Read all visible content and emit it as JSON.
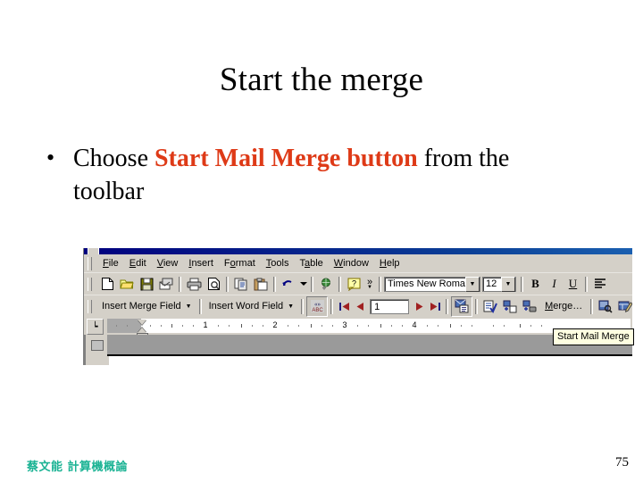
{
  "slide": {
    "title": "Start the merge",
    "bullet": {
      "marker": "•",
      "text_before": "Choose ",
      "highlight": "Start Mail Merge button",
      "text_after": " from the",
      "text_line2": "toolbar",
      "highlight_color": "#DE3A17"
    },
    "footer": "蔡文能  計算機概論",
    "footer_color": "#1BB394",
    "page_number": "75"
  },
  "screenshot": {
    "menubar": [
      {
        "label": "File",
        "accel": "F",
        "rest": "ile"
      },
      {
        "label": "Edit",
        "accel": "E",
        "rest": "dit"
      },
      {
        "label": "View",
        "accel": "V",
        "rest": "iew"
      },
      {
        "label": "Insert",
        "accel": "I",
        "rest": "nsert"
      },
      {
        "label": "Format",
        "accel": "o",
        "pre": "F",
        "rest": "rmat"
      },
      {
        "label": "Tools",
        "accel": "T",
        "rest": "ools"
      },
      {
        "label": "Table",
        "accel": "a",
        "pre": "T",
        "rest": "ble"
      },
      {
        "label": "Window",
        "accel": "W",
        "rest": "indow"
      },
      {
        "label": "Help",
        "accel": "H",
        "rest": "elp"
      }
    ],
    "standard_toolbar": {
      "icons": [
        "new-document-icon",
        "open-folder-icon",
        "save-icon",
        "email-icon",
        "print-icon",
        "print-preview-icon",
        "copy-icon",
        "paste-icon",
        "undo-icon",
        "insert-hyperlink-icon",
        "help-icon"
      ],
      "overflow_label": "»",
      "font_name": "Times New Roman",
      "font_size": "12",
      "bold_label": "B",
      "italic_label": "I",
      "underline_label": "U"
    },
    "mailmerge_toolbar": {
      "insert_merge_field": "Insert Merge Field",
      "insert_word_field": "Insert Word Field",
      "view_merged_data_icon": "view-merged-data-icon",
      "first_record_icon": "first-record-icon",
      "prev_record_icon": "previous-record-icon",
      "record_number": "1",
      "next_record_icon": "next-record-icon",
      "last_record_icon": "last-record-icon",
      "start_mail_merge_icon": "start-mail-merge-icon",
      "check_errors_icon": "check-errors-icon",
      "merge_to_document_icon": "merge-to-new-document-icon",
      "merge_to_printer_icon": "merge-to-printer-icon",
      "merge_button": "Merge…",
      "merge_button_accel": "M",
      "find_record_icon": "find-record-icon",
      "edit_data_source_icon": "edit-data-source-icon",
      "overflow_icon": "toolbar-overflow-icon"
    },
    "ruler": {
      "tab_selector_icon": "left-tab-stop-icon",
      "numbers": [
        "1",
        "2",
        "3",
        "4"
      ]
    },
    "tooltip": "Start Mail Merge"
  }
}
